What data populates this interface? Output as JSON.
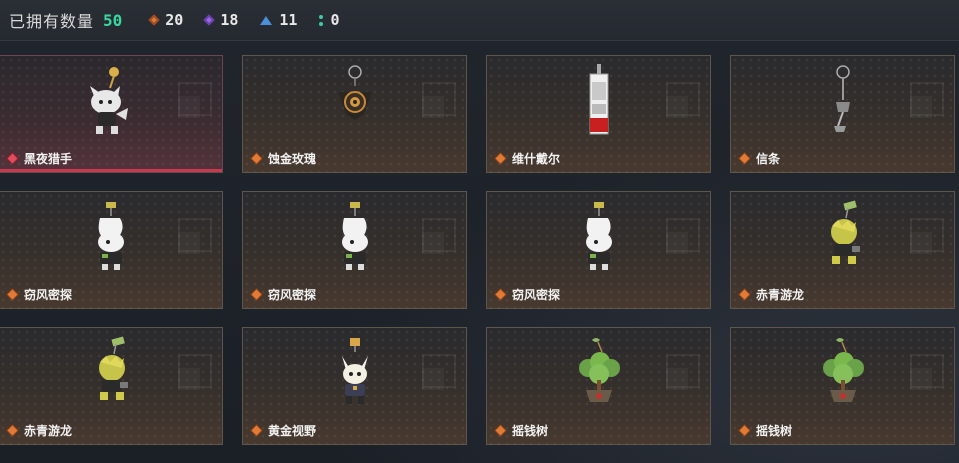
{
  "header": {
    "owned_label": "已拥有数量",
    "owned_count": "50",
    "stats": [
      {
        "rank": "S",
        "icon": "orange-diamond-icon",
        "value": "20",
        "color": "#d9793b"
      },
      {
        "rank": "A",
        "icon": "purple-diamond-icon",
        "value": "18",
        "color": "#9b6bde"
      },
      {
        "rank": "B",
        "icon": "blue-triangle-icon",
        "value": "11",
        "color": "#4a8fd8"
      },
      {
        "rank": "C",
        "icon": "green-dots-icon",
        "value": "0",
        "color": "#3fcaa6"
      }
    ]
  },
  "items": [
    {
      "name": "黑夜猎手",
      "icon": "cat-figure-charm-icon",
      "selected": true
    },
    {
      "name": "蚀金玫瑰",
      "icon": "rose-medallion-charm-icon",
      "selected": false
    },
    {
      "name": "维什戴尔",
      "icon": "card-charm-icon",
      "selected": false
    },
    {
      "name": "信条",
      "icon": "key-charm-icon",
      "selected": false
    },
    {
      "name": "窃风密探",
      "icon": "rabbit-figure-charm-icon",
      "selected": false
    },
    {
      "name": "窃风密探",
      "icon": "rabbit-figure-charm-icon",
      "selected": false
    },
    {
      "name": "窃风密探",
      "icon": "rabbit-figure-charm-icon",
      "selected": false
    },
    {
      "name": "赤青游龙",
      "icon": "dragon-figure-charm-icon",
      "selected": false
    },
    {
      "name": "赤青游龙",
      "icon": "dragon-figure-charm-icon",
      "selected": false
    },
    {
      "name": "黄金视野",
      "icon": "fox-figure-charm-icon",
      "selected": false
    },
    {
      "name": "摇钱树",
      "icon": "money-tree-charm-icon",
      "selected": false
    },
    {
      "name": "摇钱树",
      "icon": "money-tree-charm-icon",
      "selected": false
    }
  ]
}
